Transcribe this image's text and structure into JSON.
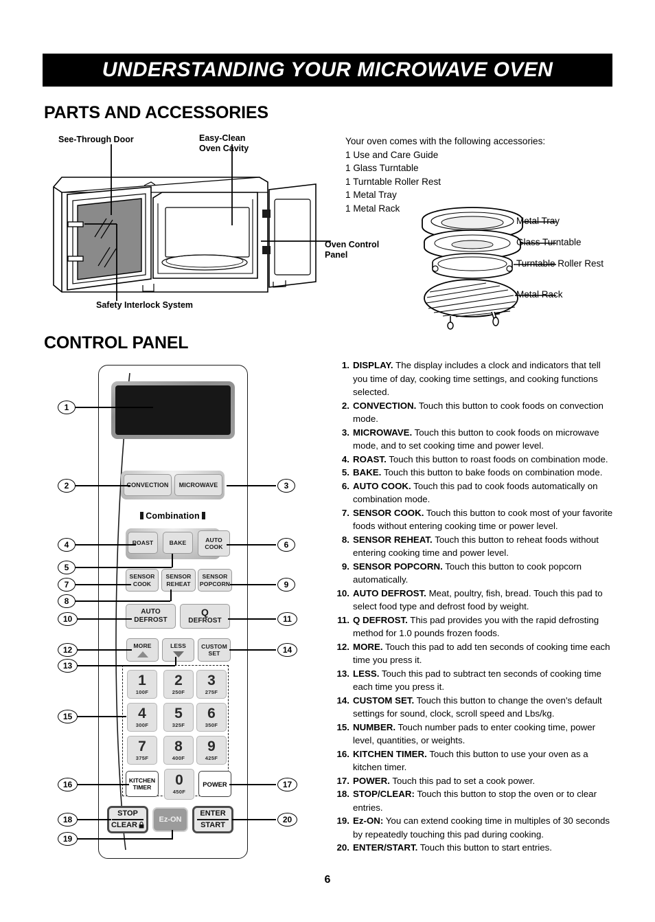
{
  "header": {
    "title": "UNDERSTANDING YOUR MICROWAVE OVEN"
  },
  "sections": {
    "parts_heading": "PARTS AND ACCESSORIES",
    "control_heading": "CONTROL PANEL"
  },
  "diagram_labels": {
    "see_through_door": "See-Through Door",
    "easy_clean_oven_cavity": "Easy-Clean\nOven Cavity",
    "safety_interlock": "Safety Interlock System",
    "oven_control_panel": "Oven Control\nPanel"
  },
  "accessories": {
    "intro": "Your oven comes with the following accessories:",
    "items": [
      "1 Use and Care Guide",
      "1 Glass Turntable",
      "1 Turntable Roller Rest",
      "1 Metal Tray",
      "1 Metal Rack"
    ],
    "callouts": {
      "metal_tray": "Metal Tray",
      "glass_turntable": "Glass Turntable",
      "turntable_roller_rest": "Turntable Roller Rest",
      "metal_rack": "Metal Rack"
    }
  },
  "panel": {
    "combination_label": "Combination",
    "buttons": {
      "convection": "CONVECTION",
      "microwave": "MICROWAVE",
      "roast": "ROAST",
      "bake": "BAKE",
      "auto_cook": "AUTO\nCOOK",
      "sensor_cook": "SENSOR\nCOOK",
      "sensor_reheat": "SENSOR\nREHEAT",
      "sensor_popcorn": "SENSOR\nPOPCORN",
      "auto_defrost": "AUTO\nDEFROST",
      "q_defrost_glyph": "Q",
      "q_defrost": "DEFROST",
      "more": "MORE",
      "less": "LESS",
      "custom_set": "CUSTOM\nSET",
      "kitchen_timer": "KITCHEN\nTIMER",
      "power": "POWER",
      "stop": "STOP",
      "clear": "CLEAR",
      "ez_on": "Ez-ON",
      "enter": "ENTER",
      "start": "START"
    },
    "keypad": [
      {
        "digit": "1",
        "temp": "100F"
      },
      {
        "digit": "2",
        "temp": "250F"
      },
      {
        "digit": "3",
        "temp": "275F"
      },
      {
        "digit": "4",
        "temp": "300F"
      },
      {
        "digit": "5",
        "temp": "325F"
      },
      {
        "digit": "6",
        "temp": "350F"
      },
      {
        "digit": "7",
        "temp": "375F"
      },
      {
        "digit": "8",
        "temp": "400F"
      },
      {
        "digit": "9",
        "temp": "425F"
      }
    ],
    "zero_key": {
      "digit": "0",
      "temp": "450F"
    },
    "callout_numbers": {
      "n1": "1",
      "n2": "2",
      "n3": "3",
      "n4": "4",
      "n5": "5",
      "n6": "6",
      "n7": "7",
      "n8": "8",
      "n9": "9",
      "n10": "10",
      "n11": "11",
      "n12": "12",
      "n13": "13",
      "n14": "14",
      "n15": "15",
      "n16": "16",
      "n17": "17",
      "n18": "18",
      "n19": "19",
      "n20": "20"
    }
  },
  "descriptions": [
    {
      "num": "1.",
      "term": "DISPLAY.",
      "text": " The display includes a clock and indicators that tell you time of day, cooking time settings, and cooking functions selected."
    },
    {
      "num": "2.",
      "term": "CONVECTION.",
      "text": " Touch this button to cook foods on convection mode."
    },
    {
      "num": "3.",
      "term": "MICROWAVE.",
      "text": " Touch this button to cook foods on microwave mode, and to set cooking time and power level."
    },
    {
      "num": "4.",
      "term": "ROAST.",
      "text": " Touch this button to roast foods on combination mode."
    },
    {
      "num": "5.",
      "term": "BAKE.",
      "text": " Touch this button to bake foods on combination mode."
    },
    {
      "num": "6.",
      "term": "AUTO COOK.",
      "text": " Touch this pad to cook foods automatically on combination mode."
    },
    {
      "num": "7.",
      "term": "SENSOR COOK.",
      "text": " Touch this button to cook most of your favorite foods without entering cooking time or power level."
    },
    {
      "num": "8.",
      "term": "SENSOR REHEAT.",
      "text": " Touch this button to reheat foods without entering cooking time and power level."
    },
    {
      "num": "9.",
      "term": "SENSOR POPCORN.",
      "text": " Touch this button to cook popcorn automatically."
    },
    {
      "num": "10.",
      "term": "AUTO DEFROST.",
      "text": " Meat, poultry, fish, bread. Touch this pad to select food type and defrost food by weight."
    },
    {
      "num": "11.",
      "term": "Q DEFROST.",
      "text": " This pad provides you with the rapid defrosting method for 1.0 pounds frozen foods."
    },
    {
      "num": "12.",
      "term": "MORE.",
      "text": " Touch this pad to add ten seconds of cooking time each time you press it."
    },
    {
      "num": "13.",
      "term": "LESS.",
      "text": " Touch this pad to subtract ten seconds of cooking time each time you press it."
    },
    {
      "num": "14.",
      "term": "CUSTOM SET.",
      "text": " Touch this button to change the oven's default settings for sound, clock, scroll speed and Lbs/kg."
    },
    {
      "num": "15.",
      "term": "NUMBER.",
      "text": " Touch number pads to enter cooking time, power level, quantities, or weights."
    },
    {
      "num": "16.",
      "term": "KITCHEN TIMER.",
      "text": " Touch this button to use your oven as a kitchen timer."
    },
    {
      "num": "17.",
      "term": "POWER.",
      "text": " Touch this pad to set a cook power."
    },
    {
      "num": "18.",
      "term": "STOP/CLEAR:",
      "text": " Touch this button to stop the oven or to clear entries."
    },
    {
      "num": "19.",
      "term": "Ez-ON:",
      "text": " You can extend cooking time in multiples of 30 seconds by repeatedly touching this pad during cooking."
    },
    {
      "num": "20.",
      "term": "ENTER/START.",
      "text": " Touch this button to start entries."
    }
  ],
  "footer": {
    "page_number": "6"
  }
}
